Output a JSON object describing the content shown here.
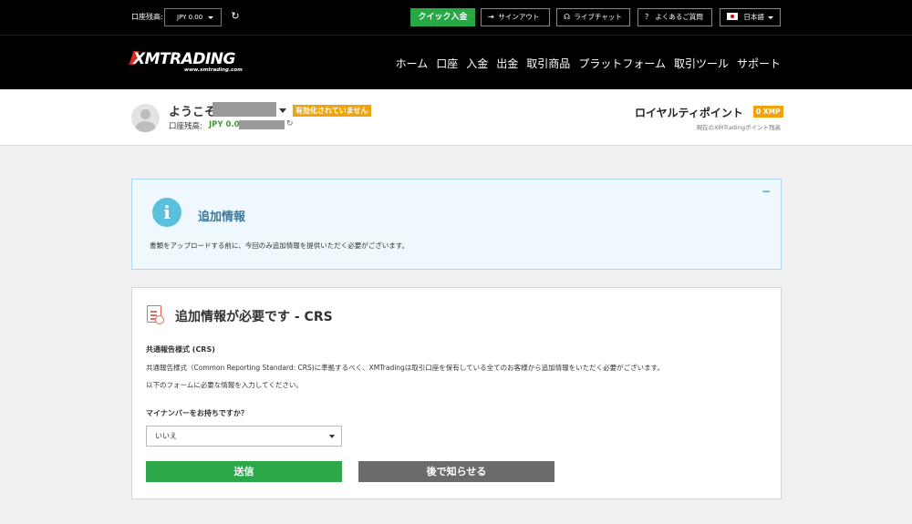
{
  "topbar": {
    "balance_label": "口座残高:",
    "balance_value": "JPY 0.00",
    "quick_deposit": "クイック入金",
    "sign_out": "サインアウト",
    "live_chat": "ライブチャット",
    "faq": "よくあるご質問",
    "language": "日本語"
  },
  "logo": {
    "main": "XMTRADING",
    "sub": "www.xmtrading.com"
  },
  "nav": [
    "ホーム",
    "口座",
    "入金",
    "出金",
    "取引商品",
    "プラットフォーム",
    "取引ツール",
    "サポート"
  ],
  "welcome": {
    "greeting": "ようこそ",
    "status_badge": "有効化されていません",
    "balance_label": "口座残高:",
    "balance_value": "JPY 0.00"
  },
  "royalty": {
    "title": "ロイヤルティポイント",
    "points": "0 XMP",
    "subtitle": "現在のXMTradingポイント残高"
  },
  "info_panel": {
    "title": "追加情報",
    "text": "書類をアップロードする前に、今回のみ追加情報を提供いただく必要がございます。",
    "collapse": "−"
  },
  "crs_panel": {
    "title": "追加情報が必要です - CRS",
    "heading": "共通報告様式 (CRS)",
    "description": "共通報告様式（Common Reporting Standard: CRS)に準拠するべく、XMTradingは取引口座を保有している全てのお客様から追加情報をいただく必要がございます。",
    "description2": "以下のフォームに必要な情報を入力してください。",
    "question": "マイナンバーをお持ちですか？",
    "select_value": "いいえ",
    "submit": "送信",
    "later": "後で知らせる"
  },
  "colors": {
    "accent_green": "#2ea64a",
    "badge_orange": "#f0a30a",
    "info_blue": "#5bc0de"
  }
}
